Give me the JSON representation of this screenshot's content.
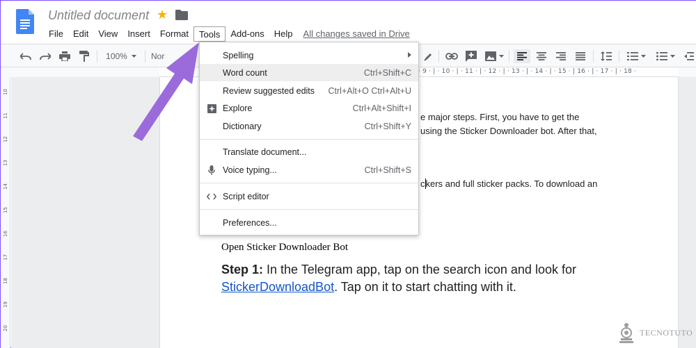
{
  "document": {
    "title": "Untitled document",
    "save_status": "All changes saved in Drive"
  },
  "menubar": {
    "items": [
      {
        "label": "File"
      },
      {
        "label": "Edit"
      },
      {
        "label": "View"
      },
      {
        "label": "Insert"
      },
      {
        "label": "Format"
      },
      {
        "label": "Tools"
      },
      {
        "label": "Add-ons"
      },
      {
        "label": "Help"
      }
    ],
    "active": "Tools"
  },
  "toolbar": {
    "zoom": "100%",
    "style_partial": "Nor"
  },
  "ruler": {
    "labels": "· 9 · | · 10 · | · 11 · | · 12 · | · 13 · | · 14 · | · 15 · | 16 · | · 17 · | · 18 ·"
  },
  "vruler": {
    "labels": [
      "10",
      "11",
      "12",
      "13",
      "14",
      "15",
      "16",
      "17",
      "18",
      "19",
      "20"
    ]
  },
  "tools_menu": {
    "items": [
      {
        "label": "Spelling",
        "shortcut": "",
        "submenu": true
      },
      {
        "label": "Word count",
        "shortcut": "Ctrl+Shift+C",
        "hover": true
      },
      {
        "label": "Review suggested edits",
        "shortcut": "Ctrl+Alt+O Ctrl+Alt+U"
      },
      {
        "label": "Explore",
        "shortcut": "Ctrl+Alt+Shift+I",
        "icon": "explore-icon"
      },
      {
        "label": "Dictionary",
        "shortcut": "Ctrl+Shift+Y"
      },
      {
        "label": "Translate document...",
        "shortcut": ""
      },
      {
        "label": "Voice typing...",
        "shortcut": "Ctrl+Shift+S",
        "icon": "microphone-icon"
      },
      {
        "label": "Script editor",
        "shortcut": "",
        "icon": "code-icon"
      },
      {
        "label": "Preferences...",
        "shortcut": ""
      }
    ]
  },
  "body": {
    "line1": "e major steps. First, you have to get the",
    "line2": "using the Sticker Downloader bot. After that,",
    "line3_a": "c",
    "line3_b": "kers and full sticker packs. To download an",
    "heading": "Open Sticker Downloader Bot",
    "step_label": "Step 1:",
    "step_text1": " In the Telegram app, tap on the search icon and look for",
    "step_link": "StickerDownloadBot",
    "step_text2": ". Tap on it to start chatting with it."
  },
  "watermark": {
    "text": "TECNOTUTO"
  },
  "colors": {
    "arrow": "#9b6bdc",
    "link": "#1155cc",
    "star": "#f4b400",
    "docs_blue": "#4285f4"
  }
}
